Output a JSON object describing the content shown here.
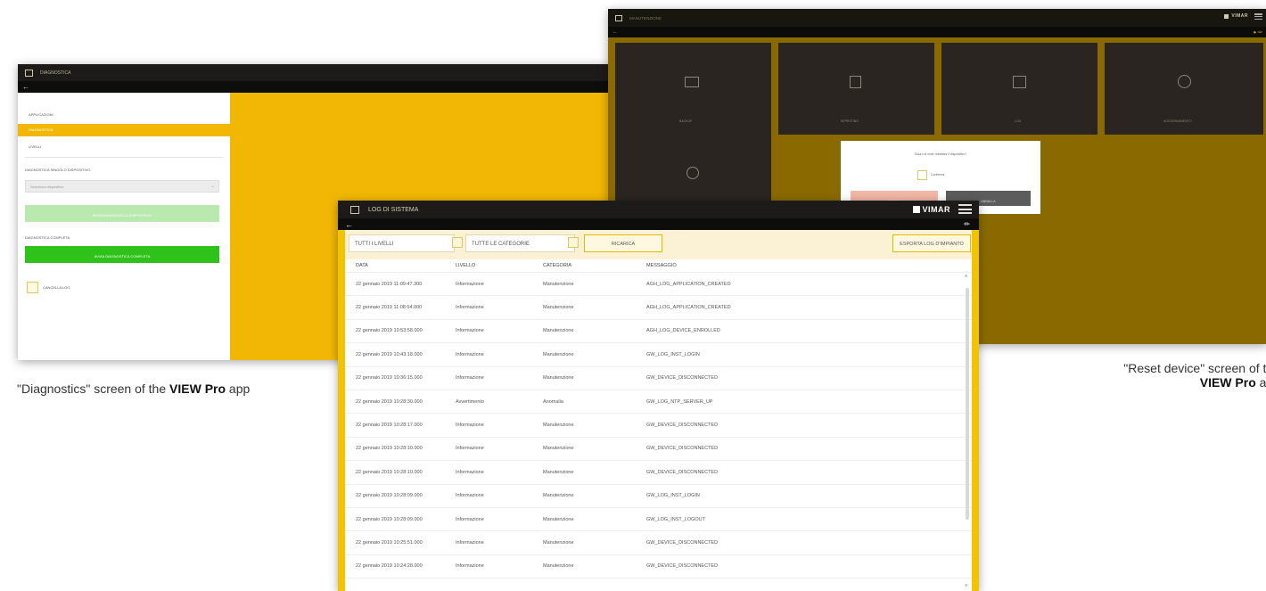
{
  "diagnostics": {
    "title": "DIAGNOSTICA",
    "menu": [
      "APPLICAZIONI",
      "DIAGNOSTICA",
      "LIVELLI"
    ],
    "section1": "DIAGNOSTICA SINGOLO DISPOSITIVO",
    "select_placeholder": "Seleziona dispositivo",
    "button1": "AVVIA DIAGNOSTICA DISPOSITIVO",
    "section2": "DIAGNOSTICA COMPLETA",
    "button2": "AVVIA DIAGNOSTICA COMPLETA",
    "checkbox": "CANCELLA LOG",
    "caption_prefix": "\"Diagnostics\" screen of the ",
    "caption_bold": "VIEW Pro",
    "caption_suffix": " app"
  },
  "reset": {
    "title": "MANUTENZIONE",
    "tiles": [
      "BACKUP",
      "RIPRISTINO",
      "LOG",
      "AGGIORNAMENTO",
      ""
    ],
    "dialog_text": "Sicuro di voler resettare il dispositivo?",
    "dialog_checkbox": "Conferma",
    "dialog_ok": "RESET",
    "dialog_cancel": "ANNULLA",
    "caption_line1": "\"Reset device\" screen of the",
    "caption_bold": "VIEW Pro",
    "caption_suffix": " app"
  },
  "log": {
    "title": "LOG DI SISTEMA",
    "brand": "VIMAR",
    "filter_levels": "TUTTI I LIVELLI",
    "filter_categories": "TUTTE LE CATEGORIE",
    "reload_button": "RICARICA",
    "export_button": "ESPORTA LOG D'IMPIANTO",
    "columns": [
      "DATA",
      "LIVELLO",
      "CATEGORIA",
      "MESSAGGIO"
    ],
    "rows": [
      [
        "22 gennaio 2019 11:09:47.300",
        "Informazione",
        "Manutenzione",
        "AGH_LOG_APPLICATION_CREATED"
      ],
      [
        "22 gennaio 2019 11:08:54.000",
        "Informazione",
        "Manutenzione",
        "AGH_LOG_APPLICATION_CREATED"
      ],
      [
        "22 gennaio 2019 10:53:58.000",
        "Informazione",
        "Manutenzione",
        "AGH_LOG_DEVICE_ENROLLED"
      ],
      [
        "22 gennaio 2019 10:43:18.000",
        "Informazione",
        "Manutenzione",
        "GW_LOG_INST_LOGIN"
      ],
      [
        "22 gennaio 2019 10:36:15.000",
        "Informazione",
        "Manutenzione",
        "GW_DEVICE_DISCONNECTED"
      ],
      [
        "22 gennaio 2019 10:28:30.000",
        "Avvertimento",
        "Anomalia",
        "GW_LOG_NTP_SERVER_UP"
      ],
      [
        "22 gennaio 2019 10:28:17.000",
        "Informazione",
        "Manutenzione",
        "GW_DEVICE_DISCONNECTED"
      ],
      [
        "22 gennaio 2019 10:28:10.000",
        "Informazione",
        "Manutenzione",
        "GW_DEVICE_DISCONNECTED"
      ],
      [
        "22 gennaio 2019 10:28:10.000",
        "Informazione",
        "Manutenzione",
        "GW_DEVICE_DISCONNECTED"
      ],
      [
        "22 gennaio 2019 10:28:09.000",
        "Informazione",
        "Manutenzione",
        "GW_LOG_INST_LOGIN"
      ],
      [
        "22 gennaio 2019 10:28:09.000",
        "Informazione",
        "Manutenzione",
        "GW_LOG_INST_LOGOUT"
      ],
      [
        "22 gennaio 2019 10:25:51.000",
        "Informazione",
        "Manutenzione",
        "GW_DEVICE_DISCONNECTED"
      ],
      [
        "22 gennaio 2019 10:24:28.000",
        "Informazione",
        "Manutenzione",
        "GW_DEVICE_DISCONNECTED"
      ]
    ]
  },
  "colors": {
    "accent": "#f2b705",
    "dark_bar": "#1c1b19",
    "green": "#2ec21a",
    "reset_bg": "#8a6a00"
  }
}
